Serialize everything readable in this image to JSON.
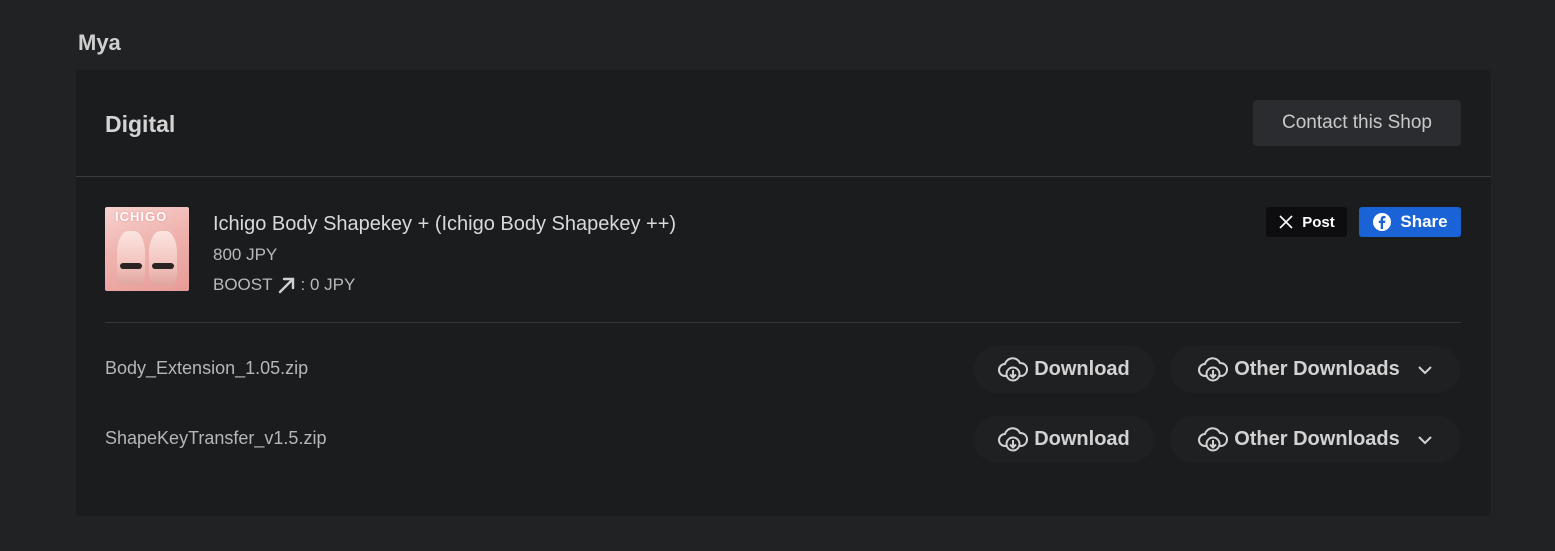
{
  "shop": {
    "name": "Mya"
  },
  "card": {
    "title": "Digital",
    "contact_label": "Contact this Shop"
  },
  "product": {
    "thumbnail_text": "ICHIGO",
    "title": "Ichigo Body Shapekey + (Ichigo Body Shapekey ++)",
    "price": "800 JPY",
    "boost_label": "BOOST",
    "boost_value": ": 0 JPY"
  },
  "share": {
    "x_label": "Post",
    "fb_label": "Share"
  },
  "files": [
    {
      "name": "Body_Extension_1.05.zip",
      "download_label": "Download",
      "other_label": "Other Downloads"
    },
    {
      "name": "ShapeKeyTransfer_v1.5.zip",
      "download_label": "Download",
      "other_label": "Other Downloads"
    }
  ],
  "icons": {
    "x": "x-logo-icon",
    "facebook": "facebook-icon",
    "download": "cloud-download-icon",
    "chevron": "chevron-down-icon",
    "boost": "arrow-up-right-icon"
  },
  "colors": {
    "page_bg": "#212224",
    "card_bg": "#1b1c1e",
    "facebook": "#1a63d6"
  }
}
